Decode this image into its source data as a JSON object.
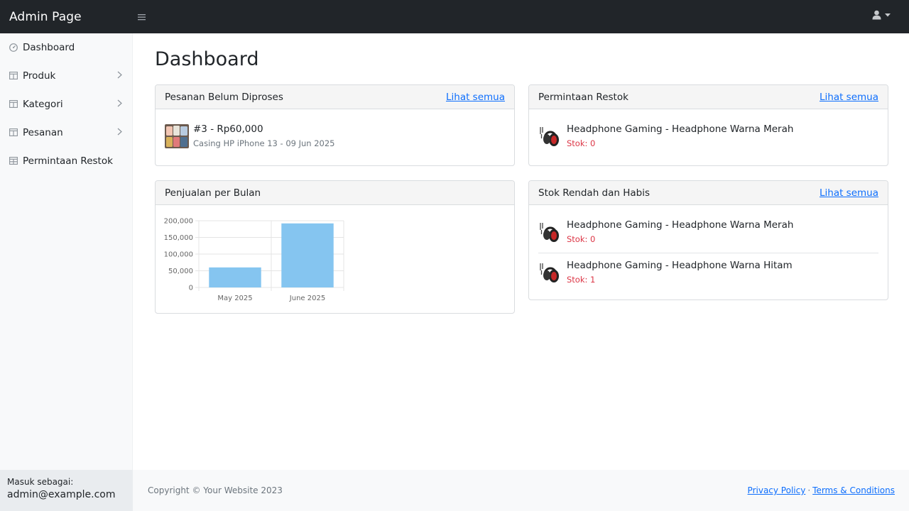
{
  "navbar": {
    "brand": "Admin Page"
  },
  "sidebar": {
    "items": [
      {
        "label": "Dashboard",
        "icon": "gauge-icon",
        "has_chevron": false
      },
      {
        "label": "Produk",
        "icon": "columns-icon",
        "has_chevron": true
      },
      {
        "label": "Kategori",
        "icon": "columns-icon",
        "has_chevron": true
      },
      {
        "label": "Pesanan",
        "icon": "columns-icon",
        "has_chevron": true
      },
      {
        "label": "Permintaan Restok",
        "icon": "table-icon",
        "has_chevron": false
      }
    ],
    "footer": {
      "label": "Masuk sebagai:",
      "email": "admin@example.com"
    }
  },
  "main": {
    "title": "Dashboard",
    "cards": {
      "pending_orders": {
        "title": "Pesanan Belum Diproses",
        "link": "Lihat semua",
        "items": [
          {
            "title": "#3 - Rp60,000",
            "subtitle": "Casing HP iPhone 13 - 09 Jun 2025"
          }
        ]
      },
      "restock_requests": {
        "title": "Permintaan Restok",
        "link": "Lihat semua",
        "items": [
          {
            "title": "Headphone Gaming - Headphone Warna Merah",
            "stock": "Stok: 0"
          }
        ]
      },
      "sales_chart": {
        "title": "Penjualan per Bulan"
      },
      "low_stock": {
        "title": "Stok Rendah dan Habis",
        "link": "Lihat semua",
        "items": [
          {
            "title": "Headphone Gaming - Headphone Warna Merah",
            "stock": "Stok: 0"
          },
          {
            "title": "Headphone Gaming - Headphone Warna Hitam",
            "stock": "Stok: 1"
          }
        ]
      }
    }
  },
  "chart_data": {
    "type": "bar",
    "categories": [
      "May 2025",
      "June 2025"
    ],
    "values": [
      60000,
      192000
    ],
    "title": "",
    "xlabel": "",
    "ylabel": "",
    "ylim": [
      0,
      200000
    ],
    "yticks": [
      "0",
      "50,000",
      "100,000",
      "150,000",
      "200,000"
    ],
    "ytick_values": [
      0,
      50000,
      100000,
      150000,
      200000
    ],
    "grid": true,
    "bar_color": "#85c5f0"
  },
  "footer": {
    "copyright": "Copyright © Your Website 2023",
    "privacy": "Privacy Policy",
    "separator": "·",
    "terms": "Terms & Conditions"
  },
  "colors": {
    "navbar_bg": "#212529",
    "link": "#0d6efd",
    "danger": "#dc3545",
    "muted": "#6c757d"
  }
}
